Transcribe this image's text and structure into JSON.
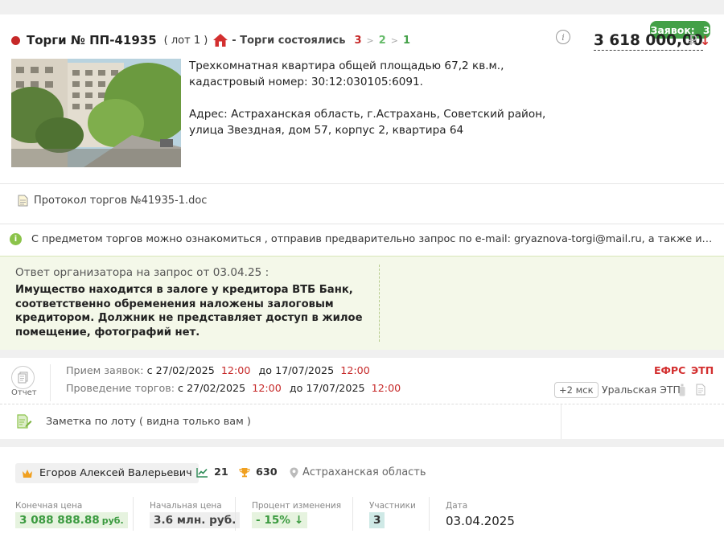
{
  "bids": {
    "label": "Заявок:",
    "count": "3"
  },
  "lot": {
    "title": "Торги № ПП-41935",
    "lot_number": "( лот 1 )",
    "status": "- Торги состоялись",
    "steps": [
      "3",
      "2",
      "1"
    ],
    "step_arrows": [
      ">",
      ">"
    ],
    "price": "3 618 000,00",
    "currency": "₽",
    "price_trend": "↓",
    "info_glyph": "i",
    "description": "Трехкомнатная квартира общей площадью 67,2 кв.м., кадастровый номер: 30:12:030105:6091.",
    "address": "Адрес: Астраханская область, г.Астрахань, Советский район, улица Звездная, дом 57, корпус 2, квартира 64"
  },
  "document": {
    "name": "Протокол торгов №41935-1.doc"
  },
  "notice": {
    "text": "С предметом торгов можно ознакомиться , отправив предварительно запрос по e-mail: gryaznova-torgi@mail.ru, а также информацию..."
  },
  "answer": {
    "heading": "Ответ организатора на запрос от 03.04.25 :",
    "body": "Имущество находится в залоге у кредитора ВТБ Банк, соответственно обременения наложены залоговым кредитором. Должник не представляет доступ в жилое помещение, фотографий нет."
  },
  "schedule": {
    "protocol_label": "Отчет",
    "applications": {
      "label": "Прием заявок:",
      "from_word": "с",
      "from_date": "27/02/2025",
      "from_time": "12:00",
      "to_word": "до",
      "to_date": "17/07/2025",
      "to_time": "12:00"
    },
    "auction": {
      "label": "Проведение торгов:",
      "from_word": "с",
      "from_date": "27/02/2025",
      "from_time": "12:00",
      "to_word": "до",
      "to_date": "17/07/2025",
      "to_time": "12:00"
    },
    "efrs": "ЕФРС",
    "etp": "ЭТП",
    "timezone": "+2 мск",
    "etp_name": "Уральская ЭТП"
  },
  "note": {
    "text": "Заметка по лоту ( видна только вам )"
  },
  "organizer": {
    "name": "Егоров Алексей Валерьевич",
    "stat_lots": "21",
    "stat_wins": "630",
    "region": "Астраханская область"
  },
  "metrics": {
    "final_price": {
      "label": "Конечная цена",
      "value": "3 088 888.88",
      "unit": "руб."
    },
    "start_price": {
      "label": "Начальная цена",
      "value": "3.6 млн. руб."
    },
    "change": {
      "label": "Процент изменения",
      "value": "- 15%",
      "trend": "↓"
    },
    "participants": {
      "label": "Участники",
      "value": "3"
    },
    "date": {
      "label": "Дата",
      "value": "03.04.2025"
    }
  },
  "colors": {
    "accent_green": "#43a047",
    "status_red": "#c62828",
    "answer_bg": "#f4f8e9"
  }
}
